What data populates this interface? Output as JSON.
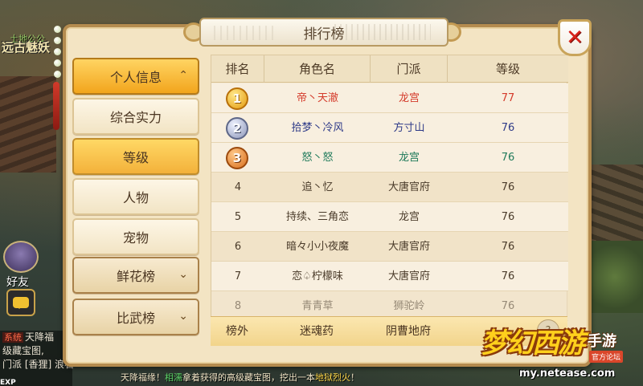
{
  "window": {
    "title": "排行榜",
    "close_label": "✕"
  },
  "background": {
    "map_name": "远古魅妖",
    "npc_name": "土地公公",
    "friend_label": "好友",
    "chat_lines": [
      {
        "tag": "系统",
        "text": "天降福"
      },
      {
        "tag": "",
        "text": "级藏宝图,"
      },
      {
        "tag": "",
        "text": "门派 [香狸] 浪石"
      }
    ],
    "exp_label": "EXP",
    "ticker_prefix": "天降福缘！",
    "ticker_name": "相濡",
    "ticker_mid": "拿着获得的高级藏宝图，挖出一本",
    "ticker_item": "地狱烈火",
    "ticker_suffix": "！"
  },
  "sidebar": {
    "categories": [
      {
        "label": "个人信息",
        "chevron": "⌃",
        "active": true
      },
      {
        "label": "鲜花榜",
        "chevron": "⌄",
        "active": false
      },
      {
        "label": "比武榜",
        "chevron": "⌄",
        "active": false
      }
    ],
    "sub_items": [
      {
        "label": "综合实力",
        "active": false
      },
      {
        "label": "等级",
        "active": true
      },
      {
        "label": "人物",
        "active": false
      },
      {
        "label": "宠物",
        "active": false
      }
    ]
  },
  "table": {
    "headers": [
      "排名",
      "角色名",
      "门派",
      "等级"
    ],
    "rows": [
      {
        "rank": "1",
        "name": "帝丶天澈",
        "school": "龙宫",
        "level": "77",
        "name_color": "#d43a2a",
        "school_color": "#d43a2a",
        "level_color": "#d43a2a"
      },
      {
        "rank": "2",
        "name": "拾梦丶冷风",
        "school": "方寸山",
        "level": "76",
        "name_color": "#2e3a88",
        "school_color": "#2e3a88",
        "level_color": "#2e3a88"
      },
      {
        "rank": "3",
        "name": "怒丶怒",
        "school": "龙宫",
        "level": "76",
        "name_color": "#1f7a5a",
        "school_color": "#1f7a5a",
        "level_color": "#1f7a5a"
      },
      {
        "rank": "4",
        "name": "追丶忆",
        "school": "大唐官府",
        "level": "76"
      },
      {
        "rank": "5",
        "name": "持续、三角恋",
        "school": "龙宫",
        "level": "76"
      },
      {
        "rank": "6",
        "name": "暗々小小夜魔",
        "school": "大唐官府",
        "level": "76"
      },
      {
        "rank": "7",
        "name": "恋♤柠檬味",
        "school": "大唐官府",
        "level": "76"
      },
      {
        "rank": "8",
        "name": "青青草",
        "school": "狮驼岭",
        "level": "76"
      }
    ],
    "outside": {
      "rank": "榜外",
      "name": "迷魂药",
      "school": "阴曹地府"
    }
  },
  "logo": {
    "title": "梦幻西游",
    "suffix": "手游",
    "forum": "官方论坛",
    "url": "my.netease.com"
  }
}
